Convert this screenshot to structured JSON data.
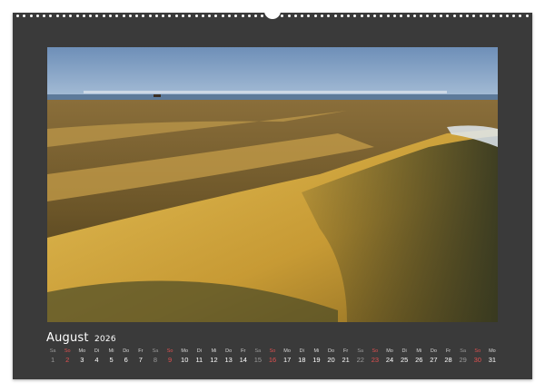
{
  "calendar": {
    "month": "August",
    "year": "2026"
  },
  "days": [
    {
      "wd": "Sa",
      "d": "1",
      "kind": "sat"
    },
    {
      "wd": "So",
      "d": "2",
      "kind": "sun"
    },
    {
      "wd": "Mo",
      "d": "3",
      "kind": "week"
    },
    {
      "wd": "Di",
      "d": "4",
      "kind": "week"
    },
    {
      "wd": "Mi",
      "d": "5",
      "kind": "week"
    },
    {
      "wd": "Do",
      "d": "6",
      "kind": "week"
    },
    {
      "wd": "Fr",
      "d": "7",
      "kind": "week"
    },
    {
      "wd": "Sa",
      "d": "8",
      "kind": "sat"
    },
    {
      "wd": "So",
      "d": "9",
      "kind": "sun"
    },
    {
      "wd": "Mo",
      "d": "10",
      "kind": "week"
    },
    {
      "wd": "Di",
      "d": "11",
      "kind": "week"
    },
    {
      "wd": "Mi",
      "d": "12",
      "kind": "week"
    },
    {
      "wd": "Do",
      "d": "13",
      "kind": "week"
    },
    {
      "wd": "Fr",
      "d": "14",
      "kind": "week"
    },
    {
      "wd": "Sa",
      "d": "15",
      "kind": "sat"
    },
    {
      "wd": "So",
      "d": "16",
      "kind": "sun"
    },
    {
      "wd": "Mo",
      "d": "17",
      "kind": "week"
    },
    {
      "wd": "Di",
      "d": "18",
      "kind": "week"
    },
    {
      "wd": "Mi",
      "d": "19",
      "kind": "week"
    },
    {
      "wd": "Do",
      "d": "20",
      "kind": "week"
    },
    {
      "wd": "Fr",
      "d": "21",
      "kind": "week"
    },
    {
      "wd": "Sa",
      "d": "22",
      "kind": "sat"
    },
    {
      "wd": "So",
      "d": "23",
      "kind": "sun"
    },
    {
      "wd": "Mo",
      "d": "24",
      "kind": "week"
    },
    {
      "wd": "Di",
      "d": "25",
      "kind": "week"
    },
    {
      "wd": "Mi",
      "d": "26",
      "kind": "week"
    },
    {
      "wd": "Do",
      "d": "27",
      "kind": "week"
    },
    {
      "wd": "Fr",
      "d": "28",
      "kind": "week"
    },
    {
      "wd": "Sa",
      "d": "29",
      "kind": "sat"
    },
    {
      "wd": "So",
      "d": "30",
      "kind": "sun"
    },
    {
      "wd": "Mo",
      "d": "31",
      "kind": "week"
    }
  ],
  "colors": {
    "page": "#3a3a3a",
    "sunday": "#e05050",
    "saturday": "#9a9a9a"
  }
}
